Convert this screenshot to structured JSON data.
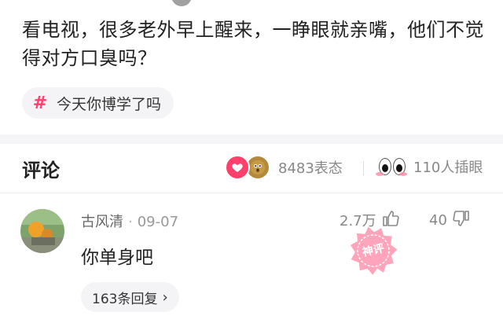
{
  "post": {
    "title": "看电视，很多老外早上醒来，一睁眼就亲嘴，他们不觉得对方口臭吗？",
    "topic": "今天你博学了吗"
  },
  "comments_section": {
    "title": "评论",
    "reaction_count": "8483表态",
    "eyes_count": "110人插眼"
  },
  "comment": {
    "author": "古风清",
    "date": "09-07",
    "text": "你单身吧",
    "likes": "2.7万",
    "dislikes": "40",
    "replies": "163条回复",
    "badge": "神评"
  },
  "colors": {
    "accent": "#ff3f6c",
    "muted_text": "#888888",
    "chip_bg": "#f4f4f6"
  },
  "icons": [
    "hash-icon",
    "heart-reaction-icon",
    "surprised-reaction-icon",
    "eyes-icon",
    "thumbs-up-icon",
    "thumbs-down-icon",
    "chevron-right-icon",
    "avatar-image",
    "god-comment-stamp"
  ]
}
